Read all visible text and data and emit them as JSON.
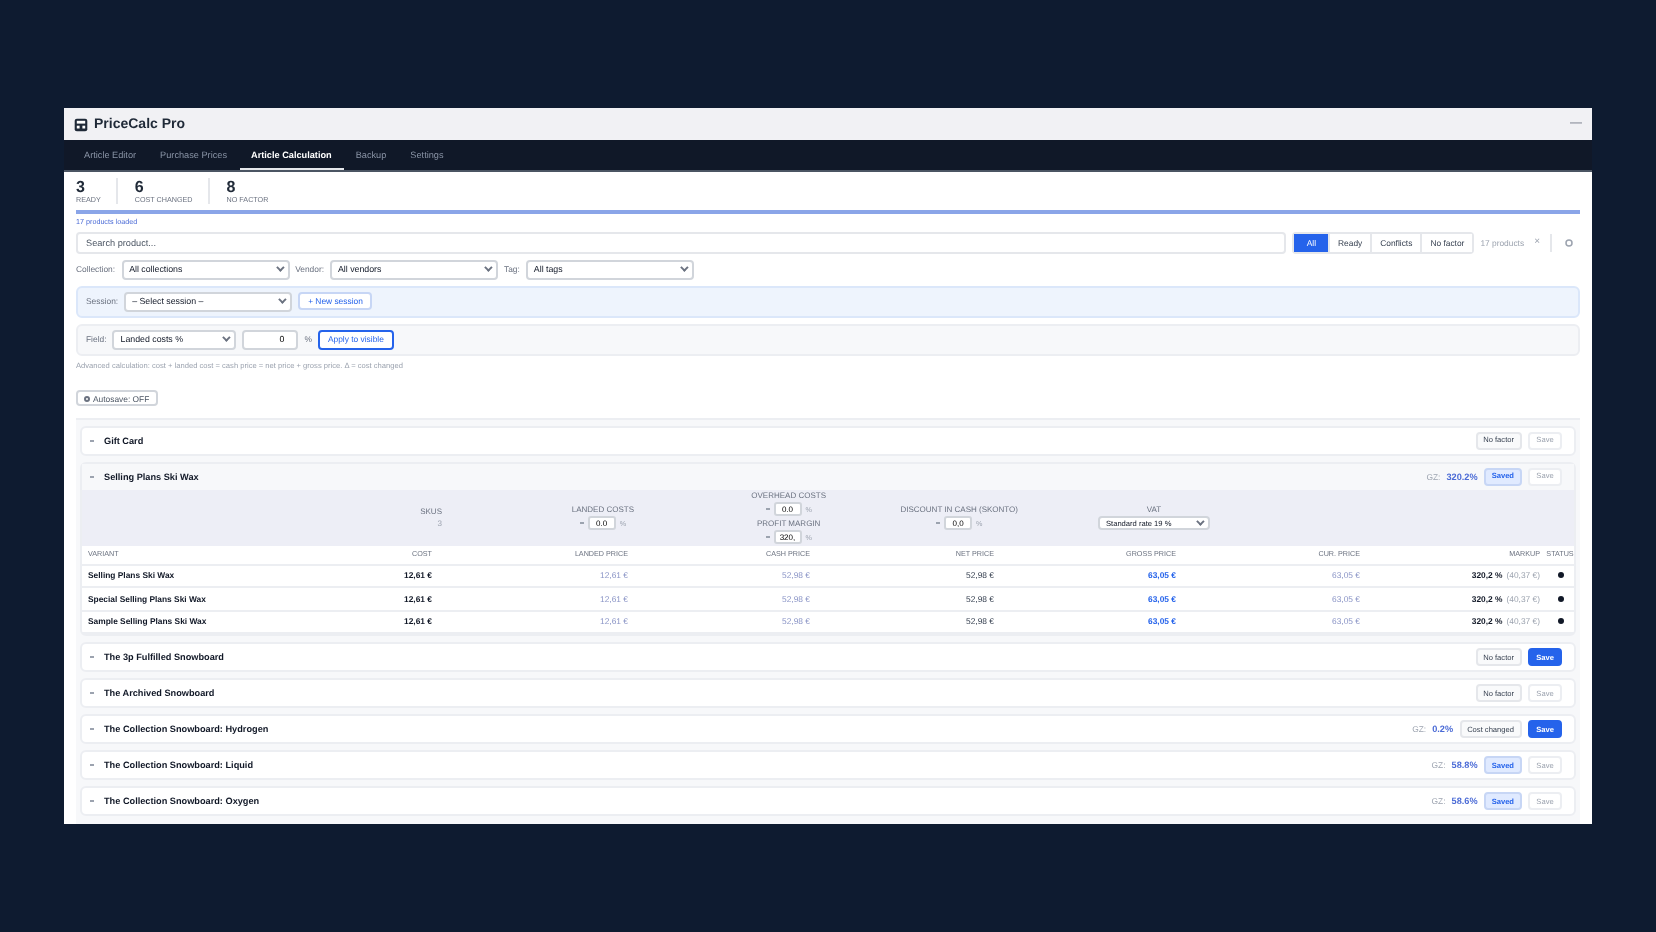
{
  "app": {
    "title": "PriceCalc Pro",
    "minimize": "—"
  },
  "nav_tabs": [
    {
      "label": "Article Editor",
      "selected": false
    },
    {
      "label": "Purchase Prices",
      "selected": false
    },
    {
      "label": "Article Calculation",
      "selected": true
    },
    {
      "label": "Backup",
      "selected": false
    },
    {
      "label": "Settings",
      "selected": false
    }
  ],
  "stats": [
    {
      "value": "3",
      "label": "READY"
    },
    {
      "value": "6",
      "label": "COST CHANGED"
    },
    {
      "value": "8",
      "label": "NO FACTOR"
    }
  ],
  "progress": {
    "level": 1
  },
  "products_loaded": "17 products loaded",
  "search": {
    "placeholder": "Search product..."
  },
  "status_filters": [
    {
      "label": "All",
      "selected": true
    },
    {
      "label": "Ready",
      "selected": false
    },
    {
      "label": "Conflicts",
      "selected": false
    },
    {
      "label": "No factor",
      "selected": false
    }
  ],
  "product_count": "17 products",
  "clear": "×",
  "filters": [
    {
      "label": "Collection:",
      "value": "All collections"
    },
    {
      "label": "Vendor:",
      "value": "All vendors"
    },
    {
      "label": "Tag:",
      "value": "All tags"
    }
  ],
  "session": {
    "label": "Session:",
    "value": "– Select session –",
    "new_button": "+ New session"
  },
  "bulk": {
    "label": "Field:",
    "field": "Landed costs %",
    "value": "0",
    "unit": "%",
    "apply": "Apply to visible"
  },
  "hint": "Advanced calculation: cost + landed cost = cash price = net price + gross price. Δ = cost changed",
  "autosave": {
    "label": "Autosave: OFF",
    "on": false
  },
  "products": [
    {
      "name": "Gift Card",
      "expanded": false,
      "badge": {
        "label": "No factor",
        "kind": "neutral"
      },
      "save": "Save",
      "save_enabled": false
    },
    {
      "name": "Selling Plans Ski Wax",
      "expanded": true,
      "gz_label": "GZ:",
      "gz": "320.2%",
      "badge": {
        "label": "Saved",
        "kind": "saved"
      },
      "save": "Save",
      "save_enabled": false,
      "params": [
        {
          "label": "SKUS",
          "value": "3",
          "kind": "text"
        },
        {
          "label": "LANDED COSTS",
          "value": "0.0",
          "unit": "%",
          "kind": "input"
        },
        {
          "label": "OVERHEAD COSTS",
          "value": "0.0",
          "unit": "%",
          "kind": "stack",
          "second_label": "PROFIT MARGIN",
          "second_value": "320,",
          "second_unit": "%"
        },
        {
          "label": "DISCOUNT IN CASH (SKONTO)",
          "value": "0,0",
          "unit": "%",
          "kind": "input"
        },
        {
          "label": "VAT",
          "value": "Standard rate 19 %",
          "kind": "select"
        }
      ],
      "columns": [
        "VARIANT",
        "COST",
        "LANDED PRICE",
        "CASH PRICE",
        "NET PRICE",
        "GROSS PRICE",
        "CUR. PRICE",
        "MARKUP",
        "STATUS"
      ],
      "rows": [
        {
          "variant": "Selling Plans Ski Wax",
          "cost": "12,61 €",
          "landed": "12,61 €",
          "cash": "52,98 €",
          "net": "52,98 €",
          "gross": "63,05 €",
          "current": "63,05 €",
          "markup": "320,2 %",
          "markup_amount": "(40,37 €)"
        },
        {
          "variant": "Special Selling Plans Ski Wax",
          "cost": "12,61 €",
          "landed": "12,61 €",
          "cash": "52,98 €",
          "net": "52,98 €",
          "gross": "63,05 €",
          "current": "63,05 €",
          "markup": "320,2 %",
          "markup_amount": "(40,37 €)"
        },
        {
          "variant": "Sample Selling Plans Ski Wax",
          "cost": "12,61 €",
          "landed": "12,61 €",
          "cash": "52,98 €",
          "net": "52,98 €",
          "gross": "63,05 €",
          "current": "63,05 €",
          "markup": "320,2 %",
          "markup_amount": "(40,37 €)"
        }
      ]
    },
    {
      "name": "The 3p Fulfilled Snowboard",
      "expanded": false,
      "badge": {
        "label": "No factor",
        "kind": "neutral"
      },
      "save": "Save",
      "save_enabled": true
    },
    {
      "name": "The Archived Snowboard",
      "expanded": false,
      "badge": {
        "label": "No factor",
        "kind": "neutral"
      },
      "save": "Save",
      "save_enabled": false
    },
    {
      "name": "The Collection Snowboard: Hydrogen",
      "expanded": false,
      "gz_label": "GZ:",
      "gz": "0.2%",
      "badge": {
        "label": "Cost changed",
        "kind": "neutral"
      },
      "save": "Save",
      "save_enabled": true
    },
    {
      "name": "The Collection Snowboard: Liquid",
      "expanded": false,
      "gz_label": "GZ:",
      "gz": "58.8%",
      "badge": {
        "label": "Saved",
        "kind": "saved"
      },
      "save": "Save",
      "save_enabled": false
    },
    {
      "name": "The Collection Snowboard: Oxygen",
      "expanded": false,
      "gz_label": "GZ:",
      "gz": "58.6%",
      "badge": {
        "label": "Saved",
        "kind": "saved"
      },
      "save": "Save",
      "save_enabled": false
    }
  ]
}
